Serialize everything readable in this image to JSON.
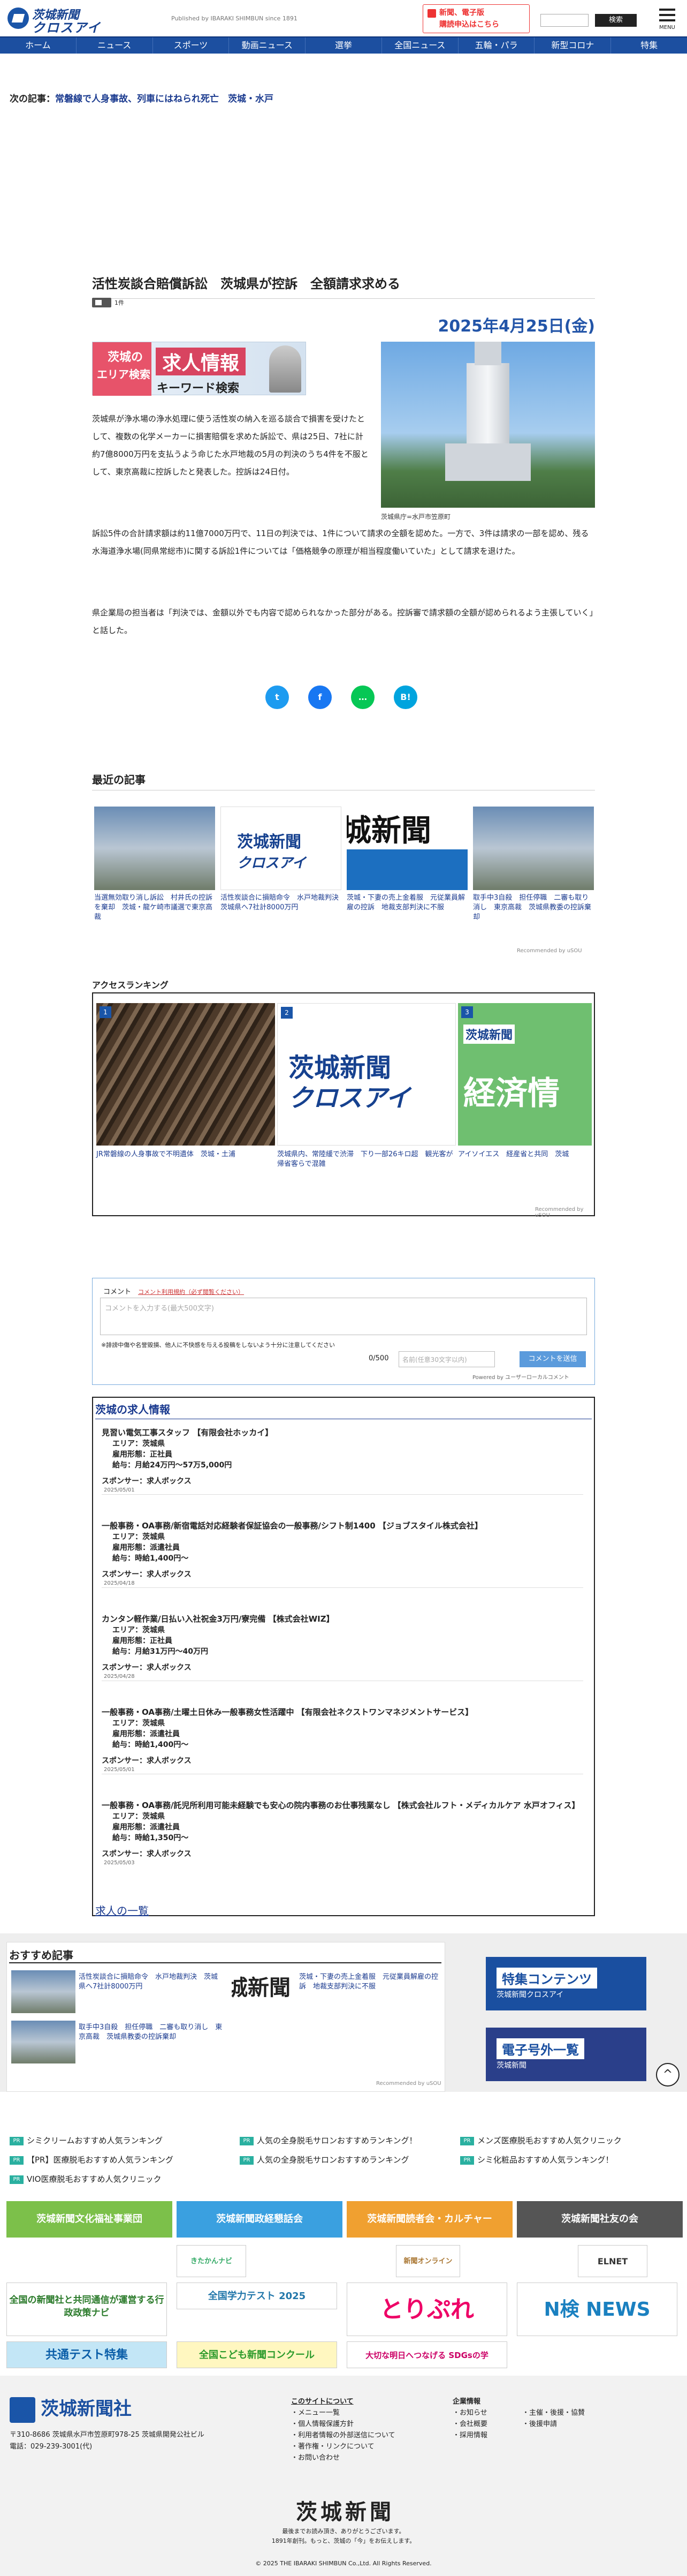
{
  "header": {
    "logo_top": "茨城新聞",
    "logo_bottom": "クロスアイ",
    "publisher": "Published by IBARAKI SHIMBUN since 1891",
    "news_btn": "新聞、電子版\n購読申込はこちら",
    "search_btn": "検索",
    "menu": "MENU"
  },
  "nav": [
    "ホーム",
    "ニュース",
    "スポーツ",
    "動画ニュース",
    "選挙",
    "全国ニュース",
    "五輪・パラ",
    "新型コロナ",
    "特集"
  ],
  "next": {
    "label": "次の記事：",
    "link": "常磐線で人身事故、列車にはねられ死亡　茨城・水戸"
  },
  "article": {
    "title": "活性炭談合賠償訴訟　茨城県が控訴　全額請求求める",
    "views": "1件",
    "date": "2025年4月25日(金)",
    "job_banner": {
      "l1": "茨城の",
      "l2": "エリア検索",
      "big": "求人情報",
      "kw": "キーワード検索"
    },
    "caption": "茨城県庁=水戸市笠原町",
    "p1": "茨城県が浄水場の浄水処理に使う活性炭の納入を巡る談合で損害を受けたとして、複数の化学メーカーに損害賠償を求めた訴訟で、県は25日、7社に計約7億8000万円を支払うよう命じた水戸地裁の5月の判決のうち4件を不服として、東京高裁に控訴したと発表した。控訴は24日付。",
    "p2": "訴訟5件の合計請求額は約11億7000万円で、11日の判決では、1件について請求の全額を認めた。一方で、3件は請求の一部を認め、残る水海道浄水場(同県常総市)に関する訴訟1件については「価格競争の原理が相当程度働いていた」として請求を退けた。",
    "p3": "県企業局の担当者は「判決では、金額以外でも内容で認められなかった部分がある。控訴審で請求額の全額が認められるよう主張していく」と話した。"
  },
  "share": [
    "t",
    "f",
    "…",
    "B!"
  ],
  "recent": {
    "title": "最近の記事",
    "items": [
      "当選無効取り消し訴訟　村井氏の控訴を棄却　茨城・龍ケ崎市議選で東京高裁",
      "活性炭談合に損賠命令　水戸地裁判決　茨城県へ7社計8000万円",
      "茨城・下妻の売上金着服　元従業員解雇の控訴　地裁支部判決に不服",
      "取手中3自殺　担任停職　二審も取り消し　東京高裁　茨城県教委の控訴棄却"
    ],
    "powered": "Recommended by uSOU"
  },
  "ranking": {
    "title": "アクセスランキング",
    "items": [
      {
        "n": "1",
        "text": "JR常磐線の人身事故で不明遺体　茨城・土浦"
      },
      {
        "n": "2",
        "text": "茨城県内、常陸緩で渋滞　下り一部26キロ超　観光客が帰省客らで混雑"
      },
      {
        "n": "3",
        "text": "アイソイエス　経産省と共同　茨城"
      }
    ],
    "powered": "Recommended by uSOU"
  },
  "comment": {
    "label": "コメント",
    "link": "コメント利用規約（必ず閲覧ください）",
    "placeholder": "コメントを入力する(最大500文字)",
    "note": "※誹謗中傷や名誉毀損、他人に不快感を与える投稿をしないよう十分に注意してください",
    "count": "0/500",
    "name_ph": "名前(任意30文字以内)",
    "submit": "コメントを送信",
    "powered": "Powered by ユーザーローカルコメント"
  },
  "jobs": {
    "title": "茨城の求人情報",
    "more": "求人の一覧",
    "items": [
      {
        "t": "見習い電気工事スタッフ 【有限会社ホッカイ】",
        "area": "エリア：茨城県",
        "type": "雇用形態：正社員",
        "pay": "給与：月給24万円～57万5,000円",
        "sp": "スポンサー：求人ボックス",
        "d": "2025/05/01"
      },
      {
        "t": "一般事務・OA事務/新宿電話対応経験者保証協会の一般事務/シフト制1400 【ジョブスタイル株式会社】",
        "area": "エリア：茨城県",
        "type": "雇用形態：派遣社員",
        "pay": "給与：時給1,400円～",
        "sp": "スポンサー：求人ボックス",
        "d": "2025/04/18"
      },
      {
        "t": "カンタン軽作業/日払い入社祝金3万円/寮完備 【株式会社WIZ】",
        "area": "エリア：茨城県",
        "type": "雇用形態：正社員",
        "pay": "給与：月給31万円～40万円",
        "sp": "スポンサー：求人ボックス",
        "d": "2025/04/28"
      },
      {
        "t": "一般事務・OA事務/土曜土日休み一般事務女性活躍中 【有限会社ネクストワンマネジメントサービス】",
        "area": "エリア：茨城県",
        "type": "雇用形態：派遣社員",
        "pay": "給与：時給1,400円～",
        "sp": "スポンサー：求人ボックス",
        "d": "2025/05/01"
      },
      {
        "t": "一般事務・OA事務/託児所利用可能未経験でも安心の院内事務のお仕事残業なし 【株式会社ルフト・メディカルケア 水戸オフィス】",
        "area": "エリア：茨城県",
        "type": "雇用形態：派遣社員",
        "pay": "給与：時給1,350円～",
        "sp": "スポンサー：求人ボックス",
        "d": "2025/05/03"
      }
    ]
  },
  "recommend": {
    "title": "おすすめ記事",
    "items": [
      "活性炭談合に損賠命令　水戸地裁判決　茨城県へ7社計8000万円",
      "茨城・下妻の売上金着服　元従業員解雇の控訴　地裁支部判決に不服",
      "取手中3自殺　担任停職　二審も取り消し　東京高裁　茨城県教委の控訴棄却"
    ],
    "banner1": "特集コンテンツ",
    "banner1_sub": "茨城新聞クロスアイ",
    "banner2": "電子号外一覧",
    "banner2_sub": "茨城新聞",
    "powered": "Recommended by uSOU"
  },
  "tags": [
    "シミクリームおすすめ人気ランキング",
    "人気の全身脱毛サロンおすすめランキング！",
    "メンズ医療脱毛おすすめ人気クリニック",
    "【PR】医療脱毛おすすめ人気ランキング",
    "人気の全身脱毛サロンおすすめランキング",
    "シミ化粧品おすすめ人気ランキング！",
    "VIO医療脱毛おすすめ人気クリニック"
  ],
  "tag_badge": "PR",
  "assoc": [
    "茨城新聞文化福祉事業団",
    "茨城新聞政経懇話会",
    "茨城新聞読者会・カルチャー",
    "茨城新聞社友の会"
  ],
  "pr_banners": [
    "全国の新聞社と共同通信が運営する行政政策ナビ",
    "きたかんナビ",
    "全国学力テスト 2025",
    "新聞オンライン",
    "とりぷれ",
    "ELNET",
    "N検 NEWS",
    "共通テスト特集",
    "全国こども新聞コンクール",
    "大切な明日へつなげる SDGsの学"
  ],
  "footer": {
    "company": "茨城新聞社",
    "addr": "〒310-8686 茨城県水戸市笠原町978-25 茨城県開発公社ビル",
    "tel": "電話：029-239-3001(代)",
    "site_h": "このサイトについて",
    "site": [
      "メニュー一覧",
      "個人情報保護方針",
      "利用者情報の外部送信について",
      "著作権・リンクについて",
      "お問い合わせ"
    ],
    "corp_h": "企業情報",
    "corp1": [
      "お知らせ",
      "会社概要",
      "採用情報"
    ],
    "corp2": [
      "主催・後援・協賛",
      "後援申請"
    ],
    "big": "茨城新聞",
    "msg": "最後までお読み頂き、ありがとうございます。\n1891年創刊。もっと、茨城の「今」をお伝えします。",
    "copy": "© 2025 THE IBARAKI SHIMBUN Co.,Ltd. All Rights Reserved."
  },
  "colors": {
    "brand": "#1c4fa0",
    "accent": "#e33",
    "teal": "#2ab0a0"
  }
}
